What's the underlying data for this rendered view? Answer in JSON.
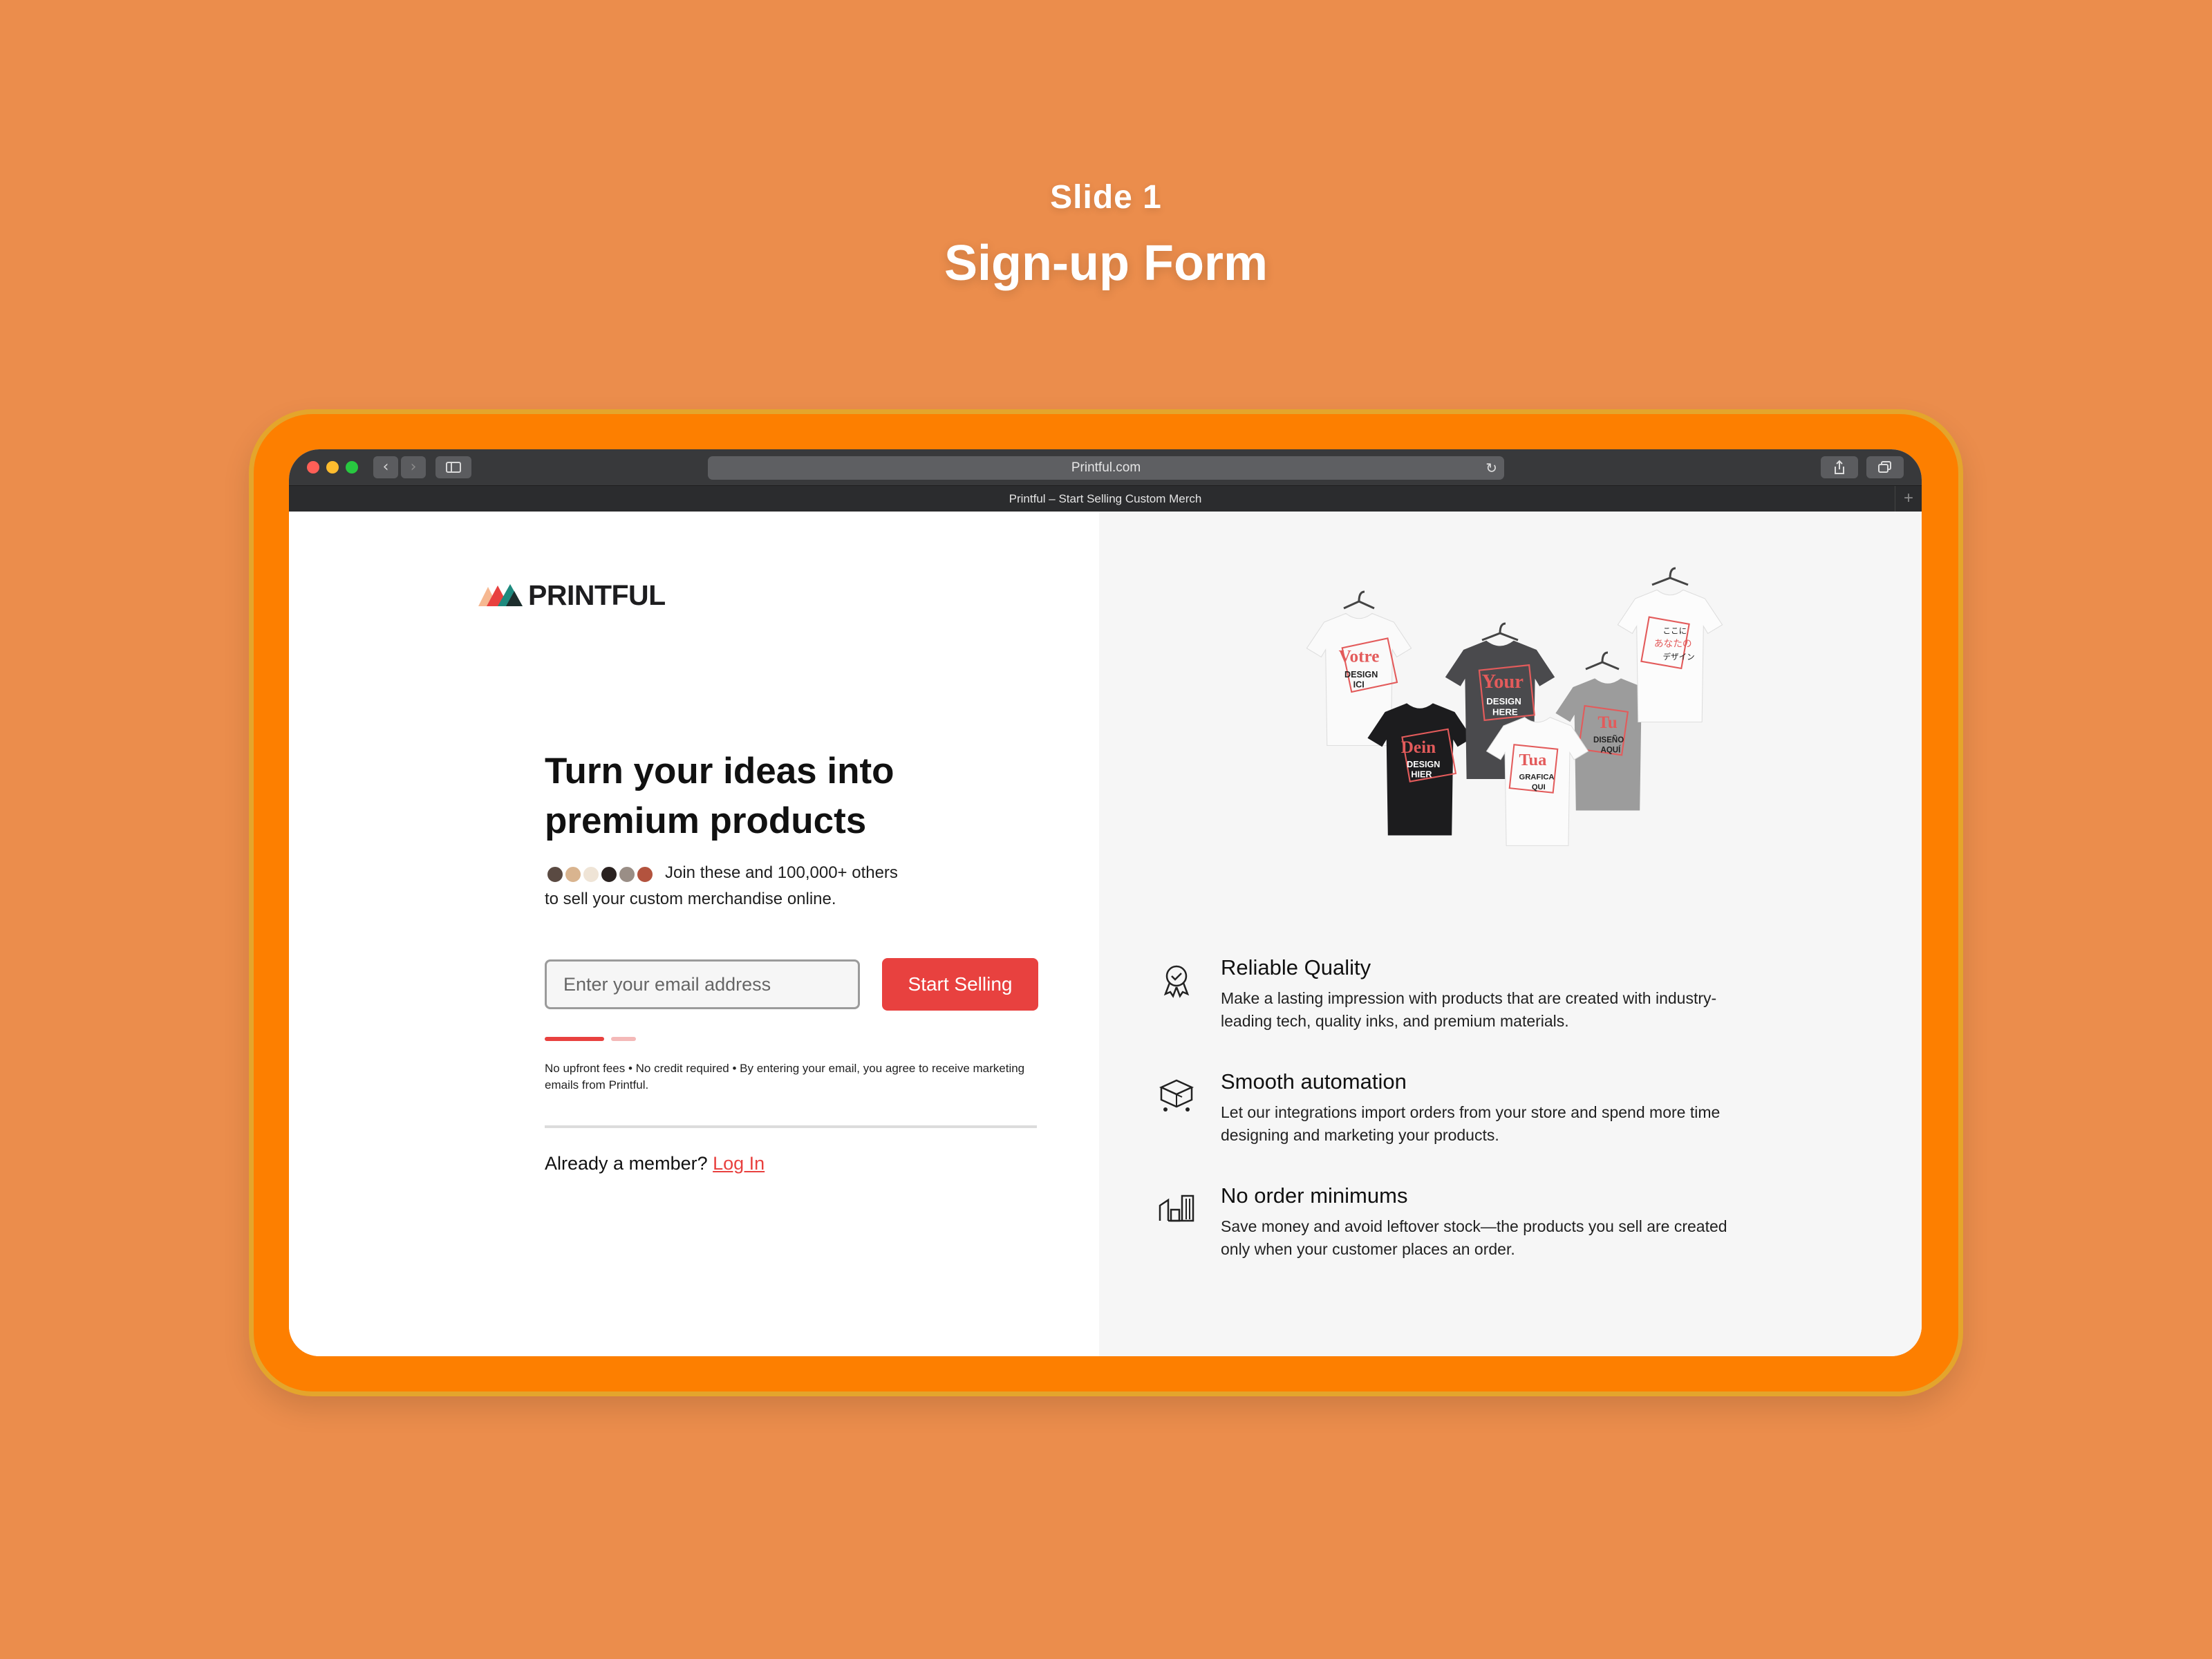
{
  "slide": {
    "label": "Slide 1",
    "title": "Sign-up Form"
  },
  "browser": {
    "url": "Printful.com",
    "tab_title": "Printful – Start Selling Custom Merch",
    "traffic_lights": {
      "close": "#FF5F57",
      "minimize": "#FEBC2E",
      "zoom": "#28C840"
    }
  },
  "brand": {
    "name": "PRINTFUL",
    "accent": "#E8413F",
    "logo_colors": [
      "#F6B891",
      "#E8413F",
      "#1E8A7E",
      "#1D1D1F"
    ]
  },
  "signup": {
    "headline": "Turn your ideas into premium products",
    "social_proof_line1": "Join these and 100,000+ others",
    "social_proof_line2": "to sell your custom merchandise online.",
    "email_placeholder": "Enter your email address",
    "cta_label": "Start Selling",
    "fine_print": "No upfront fees • No credit required • By entering your email, you agree to receive marketing emails from Printful.",
    "member_prompt": "Already a member?",
    "login_label": "Log In"
  },
  "features": [
    {
      "icon": "award-ribbon-icon",
      "title": "Reliable Quality",
      "description": "Make a lasting impression with products that are created with industry-leading tech, quality inks, and premium materials."
    },
    {
      "icon": "boxes-icon",
      "title": "Smooth automation",
      "description": "Let our integrations import orders from your store and spend more time designing and marketing your products."
    },
    {
      "icon": "warehouse-icon",
      "title": "No order minimums",
      "description": "Save money and avoid leftover stock—the products you sell are created only when your customer places an order."
    }
  ],
  "tshirt_prints": [
    {
      "word": "Votre",
      "sub1": "DESIGN",
      "sub2": "ICI"
    },
    {
      "word": "Dein",
      "sub1": "DESIGN",
      "sub2": "HIER"
    },
    {
      "word": "Your",
      "sub1": "DESIGN",
      "sub2": "HERE"
    },
    {
      "word": "Tua",
      "sub1": "GRAFICA",
      "sub2": "QUI"
    },
    {
      "word": "Tu",
      "sub1": "DISEÑO",
      "sub2": "AQUÍ"
    },
    {
      "word": "ここに",
      "sub1": "あなたの",
      "sub2": "デザイン"
    }
  ]
}
